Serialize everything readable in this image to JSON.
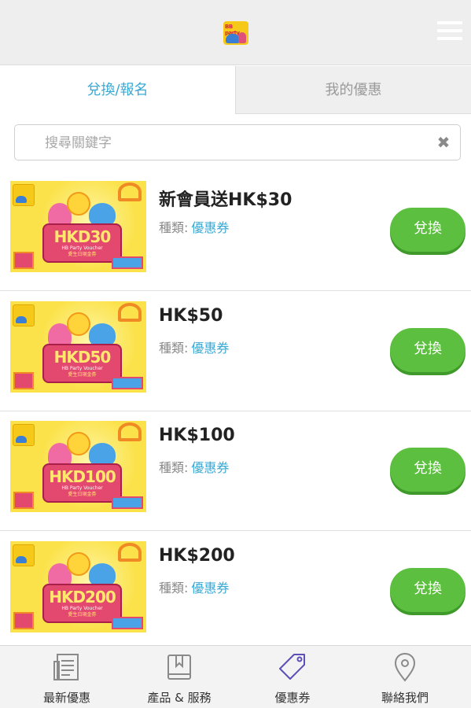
{
  "header": {
    "logo_text": "BB party",
    "menu_icon": "hamburger-menu-icon"
  },
  "tabs": [
    {
      "label": "兌換/報名",
      "active": true
    },
    {
      "label": "我的優惠",
      "active": false
    }
  ],
  "search": {
    "placeholder": "搜尋關鍵字",
    "value": "",
    "clear_icon": "close-icon"
  },
  "vouchers": [
    {
      "title": "新會員送HK$30",
      "type_label": "種類:",
      "type_value": "優惠券",
      "button": "兌換",
      "image_amount": "HKD30",
      "image_sub": "HB Party Voucher",
      "image_sub2": "愛生日現金券"
    },
    {
      "title": "HK$50",
      "type_label": "種類:",
      "type_value": "優惠券",
      "button": "兌換",
      "image_amount": "HKD50",
      "image_sub": "HB Party Voucher",
      "image_sub2": "愛生日現金券"
    },
    {
      "title": "HK$100",
      "type_label": "種類:",
      "type_value": "優惠券",
      "button": "兌換",
      "image_amount": "HKD100",
      "image_sub": "HB Party Voucher",
      "image_sub2": "愛生日現金券"
    },
    {
      "title": "HK$200",
      "type_label": "種類:",
      "type_value": "優惠券",
      "button": "兌換",
      "image_amount": "HKD200",
      "image_sub": "HB Party Voucher",
      "image_sub2": "愛生日現金券"
    }
  ],
  "bottom_nav": [
    {
      "label": "最新優惠",
      "icon": "news-icon",
      "active": false
    },
    {
      "label": "產品 & 服務",
      "icon": "book-icon",
      "active": false
    },
    {
      "label": "優惠券",
      "icon": "tag-icon",
      "active": true
    },
    {
      "label": "聯絡我們",
      "icon": "location-pin-icon",
      "active": false
    }
  ],
  "colors": {
    "accent": "#3aa9d4",
    "button_green": "#5cbf3f",
    "active_icon": "#5b4fb8"
  }
}
